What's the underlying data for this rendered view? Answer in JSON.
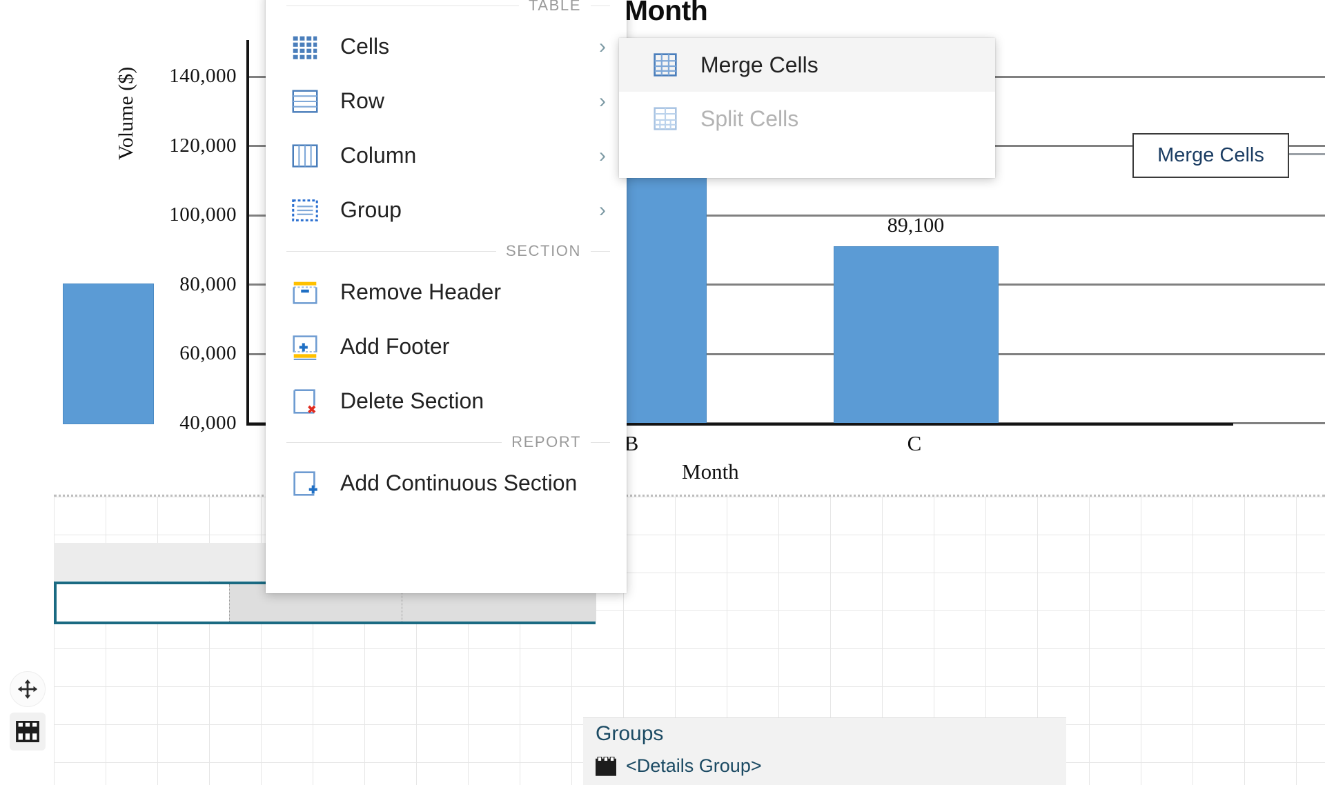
{
  "chart_data": {
    "type": "bar",
    "title": "olume by Month",
    "full_title_visible_fragment": "olume by Month",
    "xlabel": "Month",
    "ylabel": "Volume ($)",
    "categories": [
      "B",
      "C"
    ],
    "values": [
      145000,
      89100
    ],
    "bar_labels": [
      "",
      "89,100"
    ],
    "ytick_labels": [
      "140,000",
      "120,000",
      "100,000",
      "80,000",
      "60,000",
      "40,000"
    ],
    "ytick_values": [
      140000,
      120000,
      100000,
      80000,
      60000,
      40000
    ],
    "ylim": [
      40000,
      150000
    ],
    "grid": true,
    "legend": "none",
    "bar_color": "#5b9bd5"
  },
  "context_menu": {
    "groups": [
      {
        "header": "TABLE",
        "items": [
          {
            "label": "Cells",
            "icon": "cells-grid-icon",
            "submenu": true
          },
          {
            "label": "Row",
            "icon": "table-row-icon",
            "submenu": true
          },
          {
            "label": "Column",
            "icon": "table-column-icon",
            "submenu": true
          },
          {
            "label": "Group",
            "icon": "table-group-icon",
            "submenu": true
          }
        ]
      },
      {
        "header": "SECTION",
        "items": [
          {
            "label": "Remove Header",
            "icon": "remove-header-icon",
            "submenu": false
          },
          {
            "label": "Add Footer",
            "icon": "add-footer-icon",
            "submenu": false
          },
          {
            "label": "Delete Section",
            "icon": "delete-section-icon",
            "submenu": false
          }
        ]
      },
      {
        "header": "REPORT",
        "items": [
          {
            "label": "Add Continuous Section",
            "icon": "add-continuous-section-icon",
            "submenu": false
          }
        ]
      }
    ],
    "chevron_glyph": "›"
  },
  "submenu": {
    "items": [
      {
        "label": "Merge Cells",
        "icon": "merge-cells-icon",
        "disabled": false,
        "hovered": true
      },
      {
        "label": "Split Cells",
        "icon": "split-cells-icon",
        "disabled": true,
        "hovered": false
      }
    ]
  },
  "tooltip": {
    "text": "Merge Cells"
  },
  "groups_panel": {
    "title": "Groups",
    "items": [
      {
        "label": "<Details Group>",
        "icon": "details-group-icon"
      }
    ]
  },
  "gutter_handles": [
    {
      "name": "move-handle",
      "icon": "move-arrows-icon"
    },
    {
      "name": "table-handle",
      "icon": "table-selector-icon"
    }
  ],
  "colors": {
    "accent": "#5b9bd5",
    "selection": "#1a6a82",
    "menu_icon_blue": "#4a7ebb",
    "menu_icon_yellow": "#ffc000",
    "delete_red": "#e02b20",
    "chevron": "#7e9ba5"
  }
}
